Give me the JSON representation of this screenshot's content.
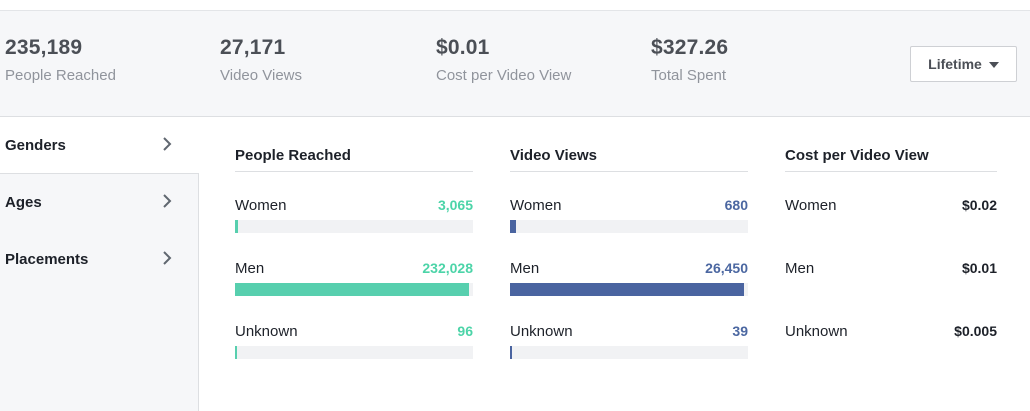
{
  "summary": [
    {
      "value": "235,189",
      "label": "People Reached"
    },
    {
      "value": "27,171",
      "label": "Video Views"
    },
    {
      "value": "$0.01",
      "label": "Cost per Video View"
    },
    {
      "value": "$327.26",
      "label": "Total Spent"
    }
  ],
  "period_button": {
    "label": "Lifetime"
  },
  "sidebar": {
    "items": [
      {
        "label": "Genders",
        "active": true
      },
      {
        "label": "Ages",
        "active": false
      },
      {
        "label": "Placements",
        "active": false
      }
    ]
  },
  "panels": [
    {
      "title": "People Reached",
      "color": "#57cfae",
      "rows": [
        {
          "label": "Women",
          "value": "3,065",
          "fraction": 0.0132
        },
        {
          "label": "Men",
          "value": "232,028",
          "fraction": 1.0
        },
        {
          "label": "Unknown",
          "value": "96",
          "fraction": 0.0004
        }
      ]
    },
    {
      "title": "Video Views",
      "color": "#4a64a0",
      "rows": [
        {
          "label": "Women",
          "value": "680",
          "fraction": 0.0257
        },
        {
          "label": "Men",
          "value": "26,450",
          "fraction": 1.0
        },
        {
          "label": "Unknown",
          "value": "39",
          "fraction": 0.0015
        }
      ]
    },
    {
      "title": "Cost per Video View",
      "rows": [
        {
          "label": "Women",
          "value": "$0.02"
        },
        {
          "label": "Men",
          "value": "$0.01"
        },
        {
          "label": "Unknown",
          "value": "$0.005"
        }
      ]
    }
  ]
}
